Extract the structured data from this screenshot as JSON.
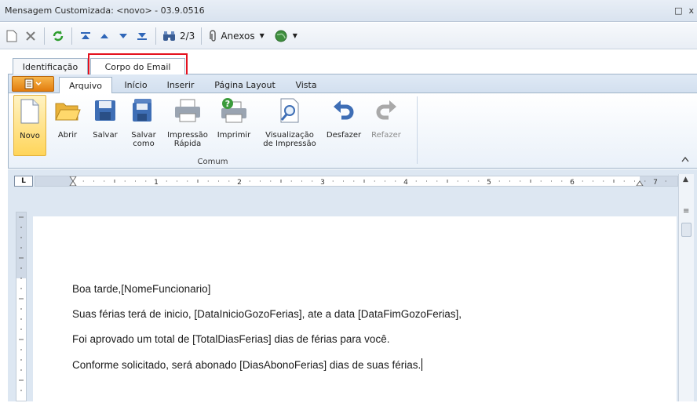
{
  "window": {
    "title": "Mensagem Customizada: <novo> - 03.9.0516",
    "controls": [
      "□",
      "x"
    ]
  },
  "toolbar": {
    "counter": "2/3",
    "attachments_label": "Anexos"
  },
  "outer_tabs": [
    {
      "label": "Identificação",
      "active": false
    },
    {
      "label": "Corpo do Email",
      "active": true,
      "highlighted": true
    }
  ],
  "ribbon": {
    "tabs": [
      {
        "label": "Arquivo",
        "active": true
      },
      {
        "label": "Início"
      },
      {
        "label": "Inserir"
      },
      {
        "label": "Página Layout"
      },
      {
        "label": "Vista"
      }
    ],
    "buttons": [
      {
        "label": "Novo",
        "icon": "new-document-icon",
        "active": true
      },
      {
        "label": "Abrir",
        "icon": "open-folder-icon"
      },
      {
        "label": "Salvar",
        "icon": "save-icon"
      },
      {
        "label": "Salvar como",
        "icon": "save-as-icon"
      },
      {
        "label": "Impressão Rápida",
        "icon": "quick-print-icon"
      },
      {
        "label": "Imprimir",
        "icon": "print-icon"
      },
      {
        "label": "Visualização de Impressão",
        "icon": "print-preview-icon"
      },
      {
        "label": "Desfazer",
        "icon": "undo-icon"
      },
      {
        "label": "Refazer",
        "icon": "redo-icon",
        "disabled": true
      }
    ],
    "group_label": "Comum"
  },
  "ruler": {
    "labels": [
      "1",
      "2",
      "3",
      "4",
      "5",
      "6",
      "7"
    ]
  },
  "document": {
    "lines": [
      "Boa tarde,[NomeFuncionario]",
      "Suas férias terá de inicio, [DataInicioGozoFerias], ate a data [DataFimGozoFerias],",
      "Foi aprovado um total de [TotalDiasFerias] dias de férias para você.",
      "Conforme solicitado, será abonado [DiasAbonoFerias] dias de suas férias."
    ]
  },
  "colors": {
    "highlight_box": "#e4111e",
    "file_button": "#e8891a",
    "accent": "#2f66b8"
  }
}
